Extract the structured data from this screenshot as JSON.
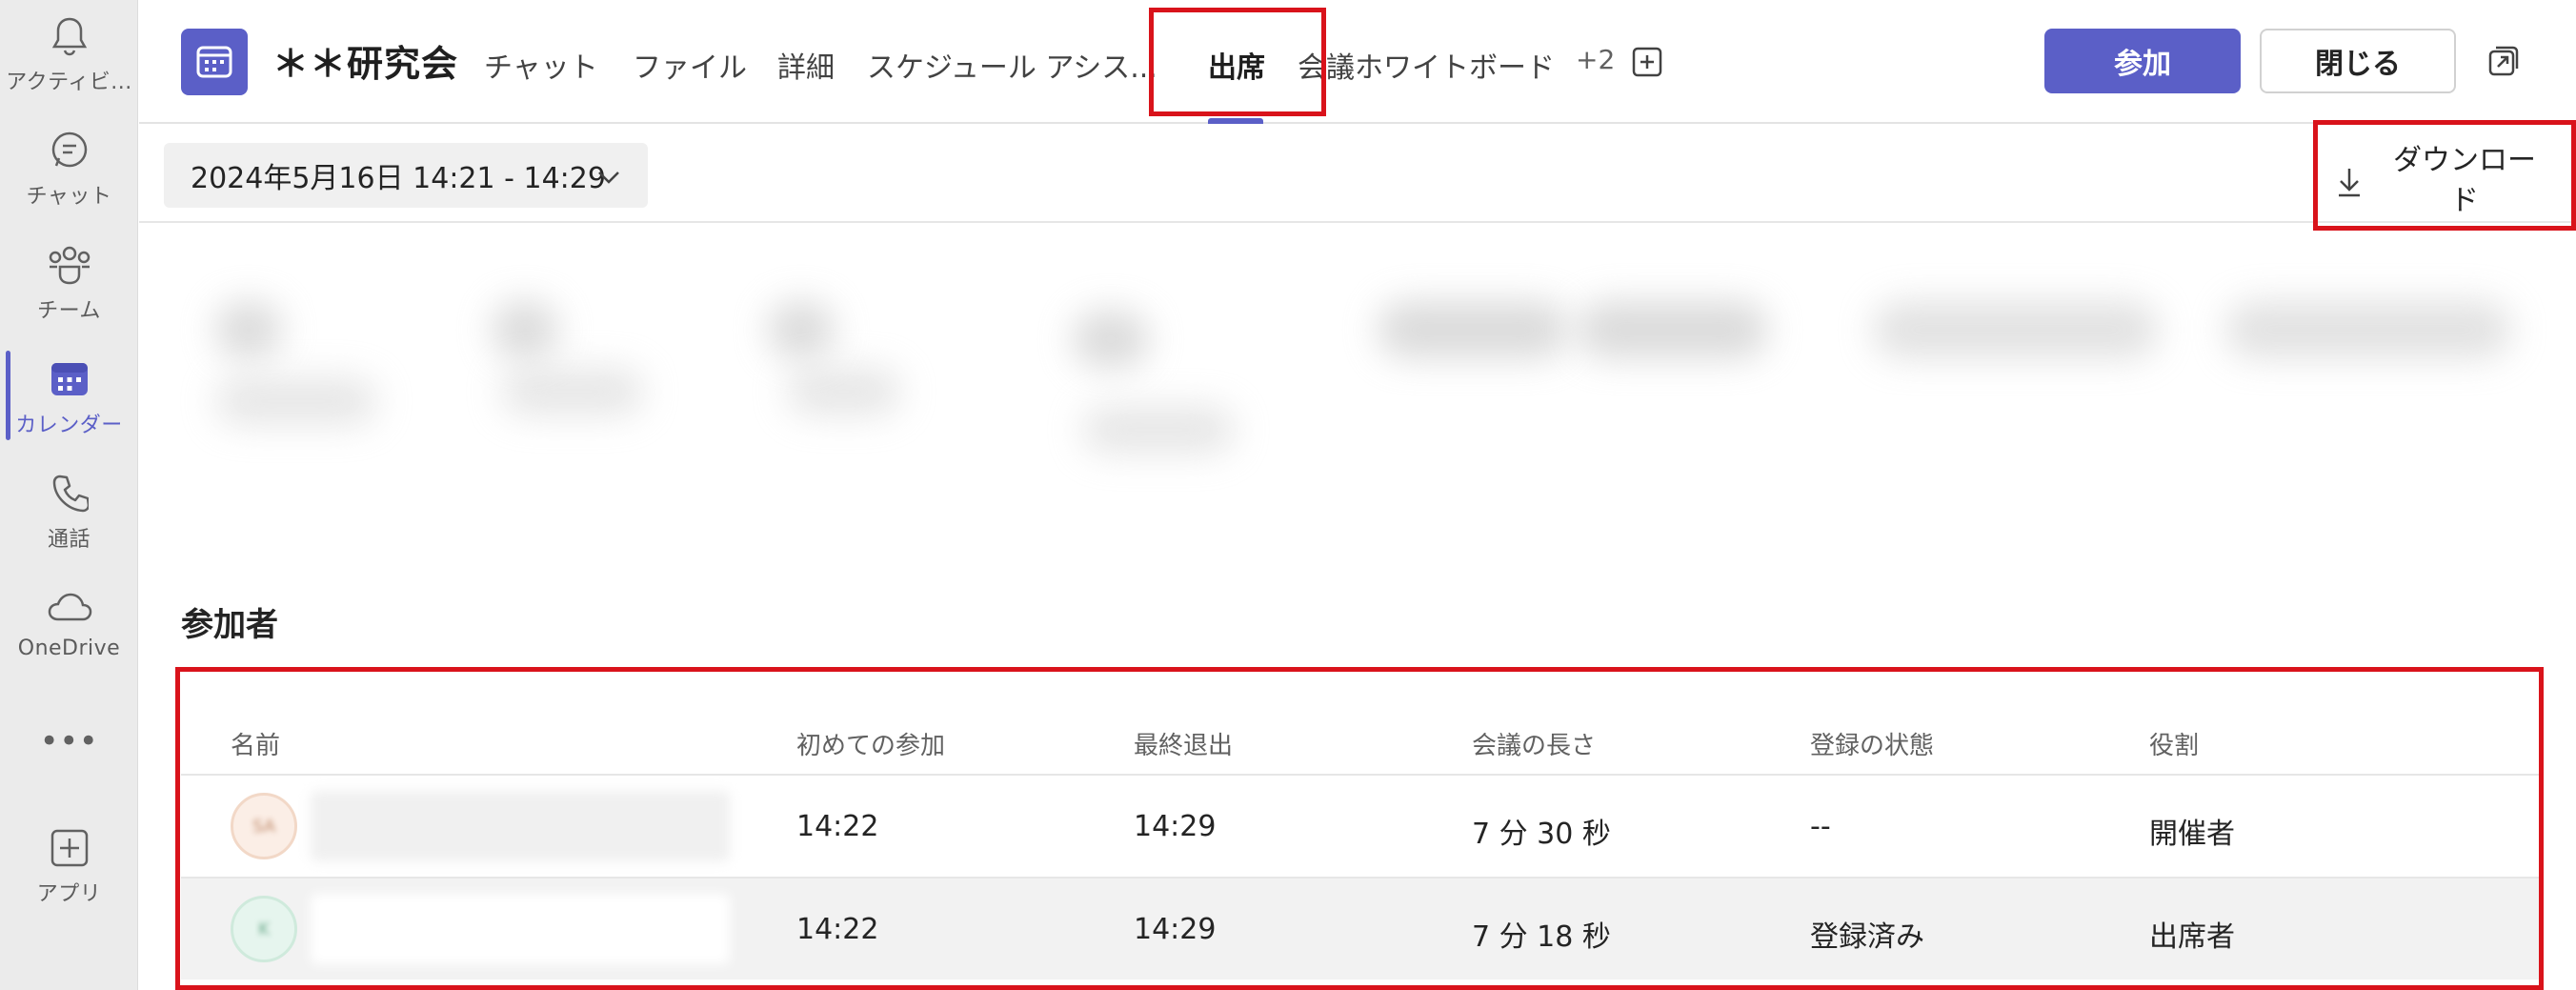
{
  "rail": {
    "items": [
      {
        "label": "アクティビ...",
        "icon": "bell-icon"
      },
      {
        "label": "チャット",
        "icon": "chat-icon"
      },
      {
        "label": "チーム",
        "icon": "teams-icon"
      },
      {
        "label": "カレンダー",
        "icon": "calendar-icon",
        "active": true
      },
      {
        "label": "通話",
        "icon": "phone-icon"
      },
      {
        "label": "OneDrive",
        "icon": "cloud-icon"
      },
      {
        "label": "•••",
        "icon": "more-icon"
      },
      {
        "label": "アプリ",
        "icon": "add-app-icon"
      }
    ]
  },
  "header": {
    "title": "＊＊研究会",
    "tabs": [
      {
        "label": "チャット"
      },
      {
        "label": "ファイル"
      },
      {
        "label": "詳細"
      },
      {
        "label": "スケジュール アシス..."
      },
      {
        "label": "出席",
        "selected": true
      },
      {
        "label": "会議ホワイトボード"
      }
    ],
    "more_tabs": "+2",
    "join_label": "参加",
    "close_label": "閉じる"
  },
  "toolbar": {
    "date_range": "2024年5月16日 14:21 - 14:29",
    "download_label": "ダウンロード"
  },
  "participants": {
    "section_title": "参加者",
    "columns": [
      "名前",
      "初めての参加",
      "最終退出",
      "会議の長さ",
      "登録の状態",
      "役割"
    ],
    "rows": [
      {
        "initials": "SA",
        "first_join": "14:22",
        "last_leave": "14:29",
        "duration": "7 分 30 秒",
        "registration": "--",
        "role": "開催者"
      },
      {
        "initials": "K",
        "first_join": "14:22",
        "last_leave": "14:29",
        "duration": "7 分 18 秒",
        "registration": "登録済み",
        "role": "出席者"
      }
    ]
  },
  "colors": {
    "accent": "#5b5fc7",
    "highlight": "#d9131b"
  }
}
